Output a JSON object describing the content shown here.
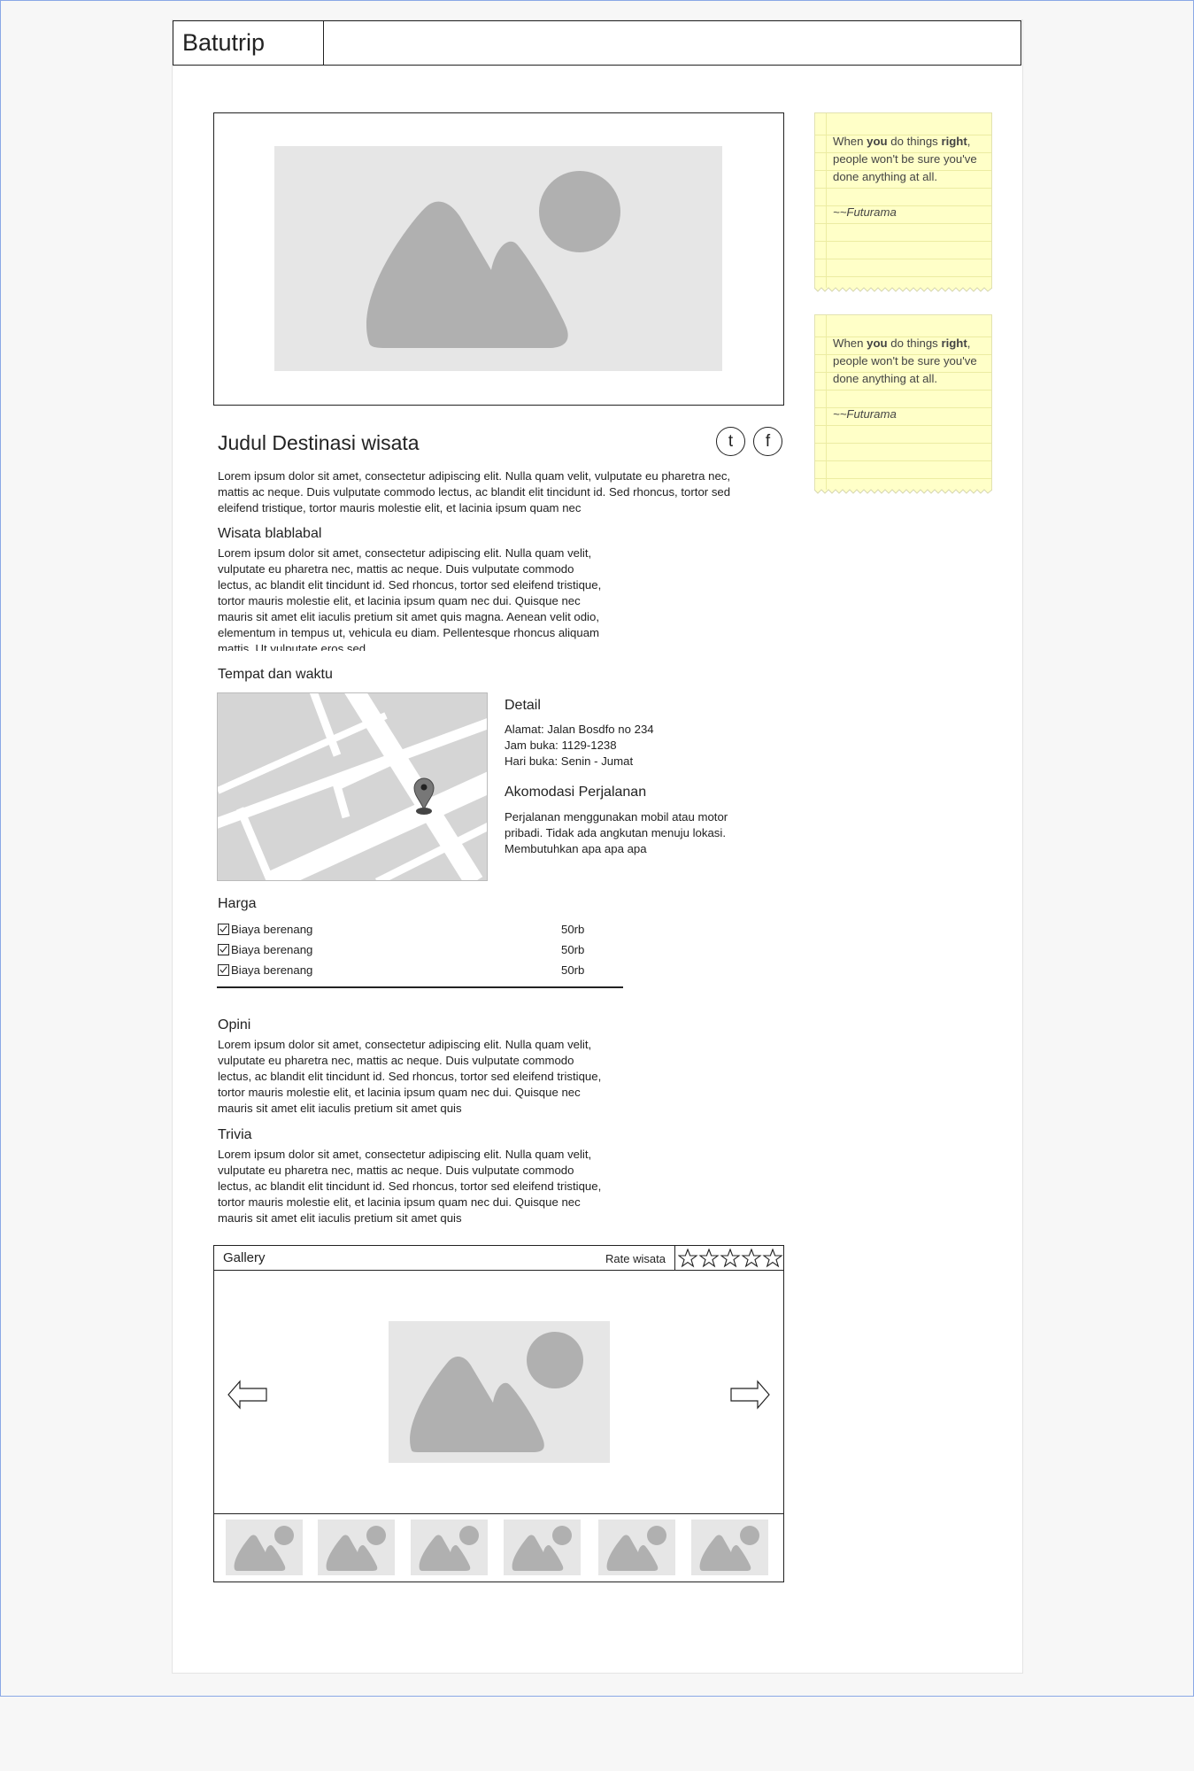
{
  "header": {
    "logo": "Batutrip"
  },
  "main": {
    "title": "Judul Destinasi wisata",
    "social": {
      "twitter": "t",
      "facebook": "f"
    },
    "intro": "Lorem ipsum dolor sit amet, consectetur adipiscing elit. Nulla quam velit, vulputate eu pharetra nec, mattis ac neque. Duis vulputate commodo lectus, ac blandit elit tincidunt id. Sed rhoncus, tortor sed eleifend tristique, tortor mauris molestie elit, et lacinia ipsum quam nec",
    "section1": {
      "heading": "Wisata blablabal",
      "text": "Lorem ipsum dolor sit amet, consectetur adipiscing elit. Nulla quam velit, vulputate eu pharetra nec, mattis ac neque. Duis vulputate commodo lectus, ac blandit elit tincidunt id. Sed rhoncus, tortor sed eleifend tristique, tortor mauris molestie elit, et lacinia ipsum quam nec dui. Quisque nec mauris sit amet elit iaculis pretium sit amet quis magna. Aenean velit odio, elementum in tempus ut, vehicula eu diam. Pellentesque rhoncus aliquam mattis. Ut vulputate eros sed"
    },
    "location": {
      "heading": "Tempat dan waktu",
      "detail_heading": "Detail",
      "address": "Alamat: Jalan Bosdfo no 234",
      "hours": "Jam buka: 1129-1238",
      "days": "Hari buka: Senin - Jumat",
      "transport_heading": "Akomodasi Perjalanan",
      "transport_text": "Perjalanan menggunakan mobil atau motor pribadi. Tidak ada angkutan menuju lokasi. Membutuhkan apa apa apa"
    },
    "price": {
      "heading": "Harga",
      "items": [
        {
          "label": "Biaya berenang",
          "value": "50rb",
          "checked": true
        },
        {
          "label": "Biaya berenang",
          "value": "50rb",
          "checked": true
        },
        {
          "label": "Biaya berenang",
          "value": "50rb",
          "checked": true
        }
      ]
    },
    "opini": {
      "heading": "Opini",
      "text": "Lorem ipsum dolor sit amet, consectetur adipiscing elit. Nulla quam velit, vulputate eu pharetra nec, mattis ac neque. Duis vulputate commodo lectus, ac blandit elit tincidunt id. Sed rhoncus, tortor sed eleifend tristique, tortor mauris molestie elit, et lacinia ipsum quam nec dui. Quisque nec mauris sit amet elit iaculis pretium sit amet quis"
    },
    "trivia": {
      "heading": "Trivia",
      "text": "Lorem ipsum dolor sit amet, consectetur adipiscing elit. Nulla quam velit, vulputate eu pharetra nec, mattis ac neque. Duis vulputate commodo lectus, ac blandit elit tincidunt id. Sed rhoncus, tortor sed eleifend tristique, tortor mauris molestie elit, et lacinia ipsum quam nec dui. Quisque nec mauris sit amet elit iaculis pretium sit amet quis"
    },
    "gallery": {
      "heading": "Gallery",
      "rate_label": "Rate wisata",
      "stars": 5,
      "thumbnail_count": 6
    }
  },
  "sidebar": {
    "notes": [
      {
        "pre": "When ",
        "bold1": "you",
        "mid": " do things ",
        "bold2": "right",
        "post": ", people won't be sure you've done anything at all.",
        "attribution": "~~Futurama"
      },
      {
        "pre": "When ",
        "bold1": "you",
        "mid": " do things ",
        "bold2": "right",
        "post": ", people won't be sure you've done anything at all.",
        "attribution": "~~Futurama"
      }
    ]
  },
  "colors": {
    "note_bg": "#ffffc8",
    "placeholder_bg": "#e6e6e6",
    "placeholder_shape": "#b0b0b0",
    "frame_border": "#8aa8e6"
  },
  "icons": [
    "twitter-icon",
    "facebook-icon",
    "map-pin-icon",
    "checkbox-icon",
    "arrow-left-icon",
    "arrow-right-icon",
    "star-icon",
    "image-placeholder-icon"
  ]
}
